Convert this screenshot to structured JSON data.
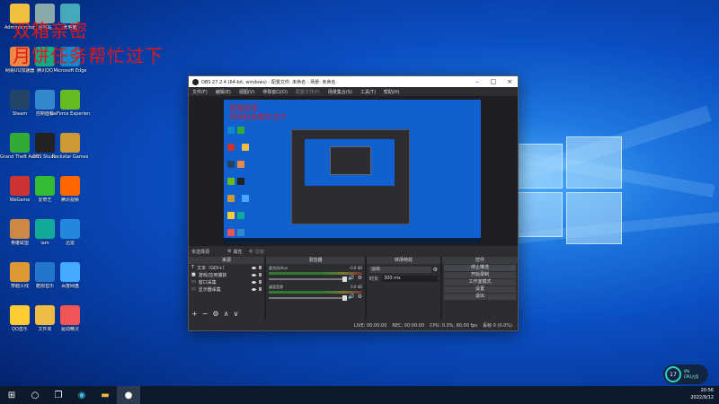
{
  "overlay": {
    "line1": "双箱亲密",
    "line2": "月饼任务帮忙过下"
  },
  "desktop_icons": [
    {
      "label": "Administrator",
      "color": "#f0c040"
    },
    {
      "label": "回收站",
      "color": "#8aa"
    },
    {
      "label": "此电脑",
      "color": "#4ab"
    },
    {
      "label": "网易UU加速器",
      "color": "#e84"
    },
    {
      "label": "腾讯QQ",
      "color": "#1a8"
    },
    {
      "label": "Microsoft Edge",
      "color": "#18c"
    },
    {
      "label": "Steam",
      "color": "#246"
    },
    {
      "label": "控制面板",
      "color": "#38c"
    },
    {
      "label": "GeForce Experience",
      "color": "#6b2"
    },
    {
      "label": "Grand Theft Auto V",
      "color": "#3a3"
    },
    {
      "label": "OBS Studio",
      "color": "#222"
    },
    {
      "label": "Rockstar Games",
      "color": "#c93"
    },
    {
      "label": "WeGame",
      "color": "#c33"
    },
    {
      "label": "爱奇艺",
      "color": "#3b3"
    },
    {
      "label": "腾讯视频",
      "color": "#f60"
    },
    {
      "label": "英雄联盟",
      "color": "#c84"
    },
    {
      "label": "iam",
      "color": "#1a9"
    },
    {
      "label": "迅雷",
      "color": "#28d"
    },
    {
      "label": "穿越火线",
      "color": "#d93"
    },
    {
      "label": "酷狗音乐",
      "color": "#27c"
    },
    {
      "label": "百度网盘",
      "color": "#4af"
    },
    {
      "label": "QQ音乐",
      "color": "#fc3"
    },
    {
      "label": "文件夹",
      "color": "#eb4"
    },
    {
      "label": "驱动精灵",
      "color": "#e55"
    }
  ],
  "obs": {
    "title": "OBS 27.2.4 (64-bit, windows) - 配置文件: 未命名 - 场景: 未命名",
    "menu": [
      "文件(F)",
      "编辑(E)",
      "视图(V)",
      "停靠窗口(D)",
      "配置文件(P)",
      "场景集合(S)",
      "工具(T)",
      "帮助(H)"
    ],
    "preview_text1": "双箱亲密",
    "preview_text2": "月饼任务帮忙过下",
    "source_bar_label": "未选择源",
    "source_bar_props": "属性",
    "source_bar_filters": "滤镜",
    "docks": {
      "scenes_header": "来源",
      "mixer_header": "混音器",
      "transitions_header": "转场特效",
      "controls_header": "控件"
    },
    "sources": [
      {
        "label": "文本（GDI+）",
        "icon": "T"
      },
      {
        "label": "游戏/应用捕获",
        "icon": "■"
      },
      {
        "label": "窗口采集",
        "icon": "▭"
      },
      {
        "label": "显示器采集",
        "icon": "▭"
      }
    ],
    "mixer": [
      {
        "name": "麦克风/Aux",
        "db": "-0.0 dB"
      },
      {
        "name": "桌面音频",
        "db": "0.0 dB"
      }
    ],
    "transition": {
      "type": "淡出",
      "duration_label": "时长",
      "duration_value": "300 ms"
    },
    "controls": [
      "停止推流",
      "开始录制",
      "工作室模式",
      "设置",
      "退出"
    ],
    "status": {
      "live": "LIVE: 00:00:00",
      "rec": "REC: 00:00:00",
      "cpu": "CPU: 0.3%, 60.00 fps",
      "dropped": "丢帧 0 (0.0%)"
    }
  },
  "taskbar": {
    "time": "20:56",
    "date": "2022/9/12"
  },
  "cpu_widget": {
    "percent": "17",
    "label1": "0%",
    "label2": "CPU占用"
  }
}
